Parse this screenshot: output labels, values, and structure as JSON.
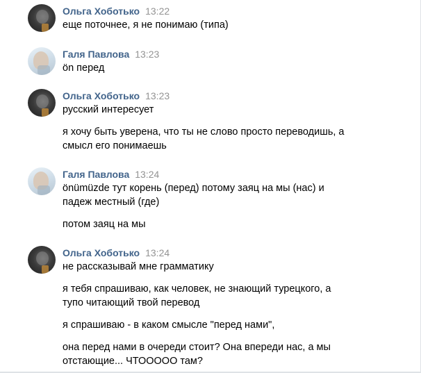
{
  "messages": [
    {
      "author": "Ольга Хоботько",
      "time": "13:22",
      "avatar": "olga-avatar",
      "lines": [
        "еще поточнее, я не понимаю (типа)"
      ]
    },
    {
      "author": "Галя Павлова",
      "time": "13:23",
      "avatar": "galya-avatar",
      "lines": [
        "ön перед"
      ]
    },
    {
      "author": "Ольга Хоботько",
      "time": "13:23",
      "avatar": "olga-avatar",
      "lines": [
        "русский интересует",
        "я хочу быть уверена, что ты не слово просто переводишь, а",
        "смысл его понимаешь"
      ]
    },
    {
      "author": "Галя Павлова",
      "time": "13:24",
      "avatar": "galya-avatar",
      "lines": [
        "önümüzde тут корень (перед) потому заяц на мы (нас) и",
        "падеж местный (где)",
        "потом заяц на мы"
      ]
    },
    {
      "author": "Ольга Хоботько",
      "time": "13:24",
      "avatar": "olga-avatar",
      "lines": [
        "не рассказывай мне грамматику",
        "я тебя спрашиваю, как человек, не знающий турецкого, а",
        "тупо читающий твой перевод",
        "я спрашиваю - в каком смысле \"перед нами\",",
        "она перед нами в очереди стоит? Она впереди нас, а мы",
        "отстающие... ЧТООООО там?"
      ]
    }
  ]
}
